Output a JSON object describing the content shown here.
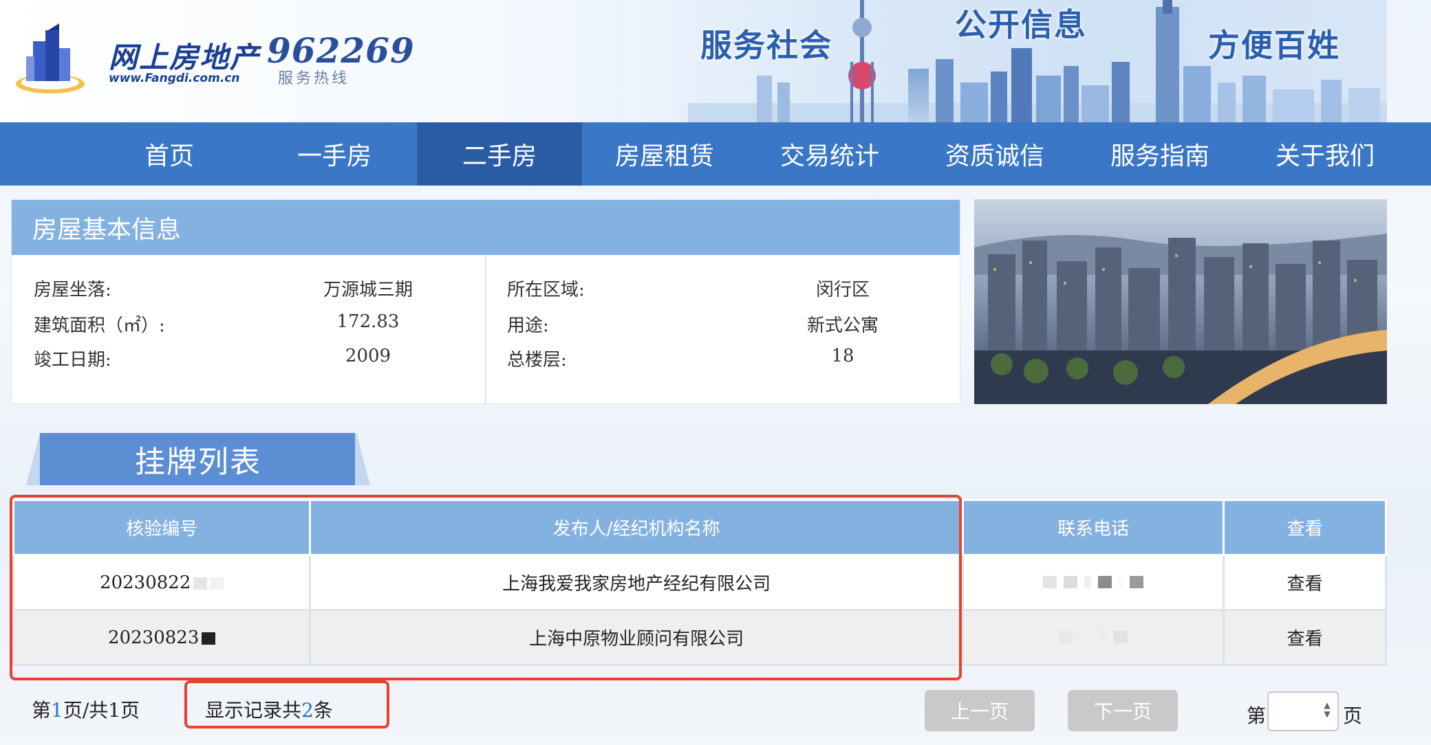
{
  "header": {
    "logo_text": "网上房地产",
    "logo_url": "www.Fangdi.com.cn",
    "hotline_number": "962269",
    "hotline_label": "服务热线",
    "slogans": [
      "服务社会",
      "公开信息",
      "方便百姓"
    ]
  },
  "nav": {
    "items": [
      {
        "label": "首页"
      },
      {
        "label": "一手房"
      },
      {
        "label": "二手房"
      },
      {
        "label": "房屋租赁"
      },
      {
        "label": "交易统计"
      },
      {
        "label": "资质诚信"
      },
      {
        "label": "服务指南"
      },
      {
        "label": "关于我们"
      }
    ],
    "active_index": 2
  },
  "house_info": {
    "title": "房屋基本信息",
    "left": [
      {
        "label": "房屋坐落:",
        "value": "万源城三期"
      },
      {
        "label": "建筑面积（㎡）:",
        "value": "172.83"
      },
      {
        "label": "竣工日期:",
        "value": "2009"
      }
    ],
    "right": [
      {
        "label": "所在区域:",
        "value": "闵行区"
      },
      {
        "label": "用途:",
        "value": "新式公寓"
      },
      {
        "label": "总楼层:",
        "value": "18"
      }
    ]
  },
  "listing": {
    "tab_title": "挂牌列表",
    "columns": [
      "核验编号",
      "发布人/经纪机构名称",
      "联系电话",
      "查看"
    ],
    "rows": [
      {
        "code": "20230822",
        "agency": "上海我爱我家房地产经纪有限公司",
        "action": "查看"
      },
      {
        "code": "20230823",
        "agency": "上海中原物业顾问有限公司",
        "action": "查看"
      }
    ]
  },
  "pagination": {
    "page_prefix": "第",
    "current_page": "1",
    "page_mid": "页/共",
    "total_pages": "1",
    "page_suffix": "页",
    "records_prefix": "显示记录共",
    "records_count": "2",
    "records_suffix": "条",
    "prev_label": "上一页",
    "next_label": "下一页",
    "goto_prefix": "第",
    "goto_suffix": "页"
  },
  "colors": {
    "nav_bg": "#3a77c6",
    "nav_active": "#2a5ca6",
    "header_blue": "#84b2e0",
    "highlight_red": "#e2432f"
  }
}
